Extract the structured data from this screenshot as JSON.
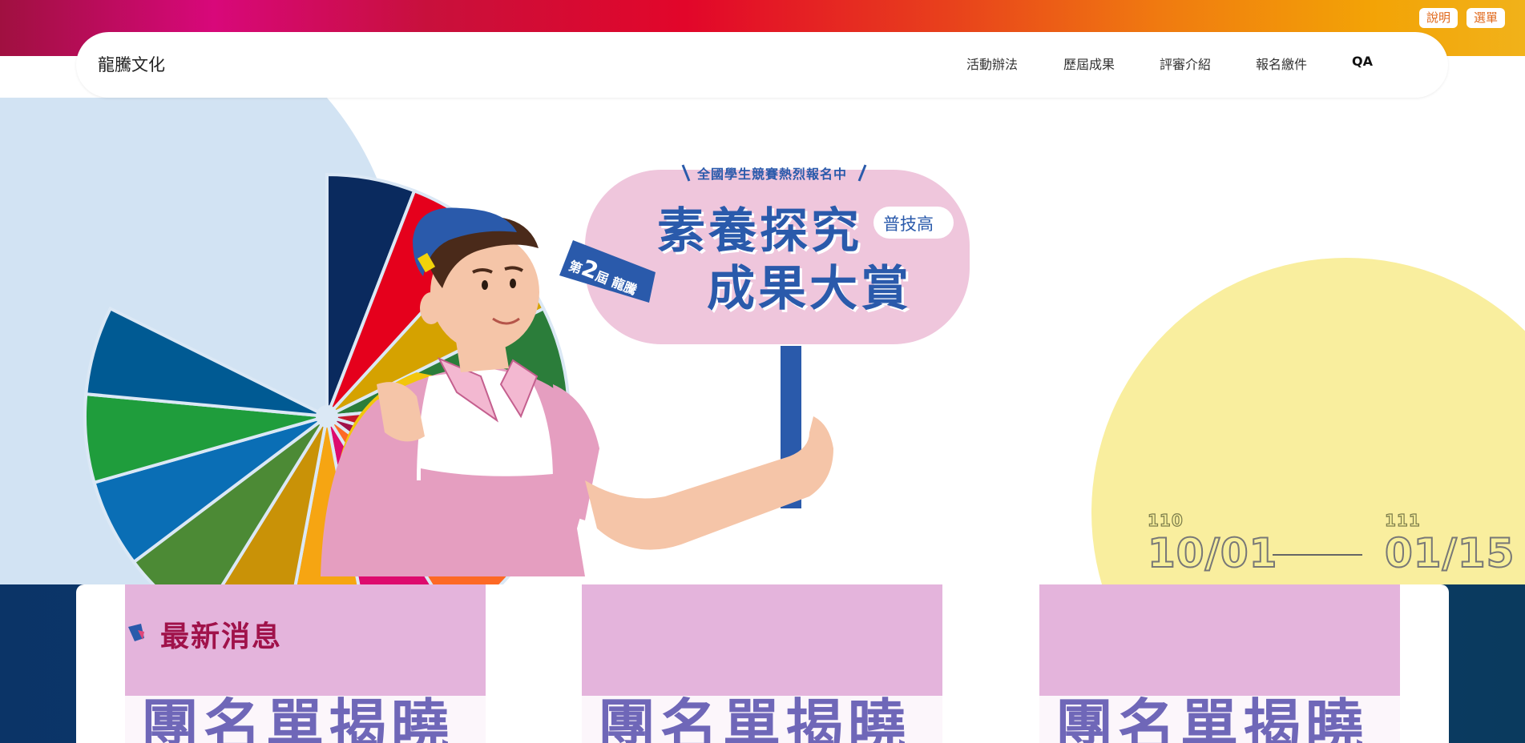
{
  "header": {
    "help_label": "說明",
    "menu_label": "選單",
    "brand": "龍騰文化",
    "nav": [
      "活動辦法",
      "歷屆成果",
      "評審介紹",
      "報名繳件",
      "QA"
    ]
  },
  "hero": {
    "tagline": "全國學生競賽熱烈報名中",
    "edition_prefix": "第",
    "edition_number": "2",
    "edition_suffix": "屆 龍騰",
    "title_line1": "素養探究",
    "title_line2": "成果大賞",
    "badge": "普技高",
    "start_year": "110",
    "start_date": "10/01",
    "end_year": "111",
    "end_date": "01/15"
  },
  "news": {
    "title": "最新消息",
    "card_image_text": "團名單揭曉"
  },
  "colors": {
    "accent_orange": "#e0691c",
    "sign_blue": "#2a5aab",
    "sign_pink": "#efc6dc",
    "card_pink": "#e4b4dc",
    "news_title": "#a0124a"
  }
}
